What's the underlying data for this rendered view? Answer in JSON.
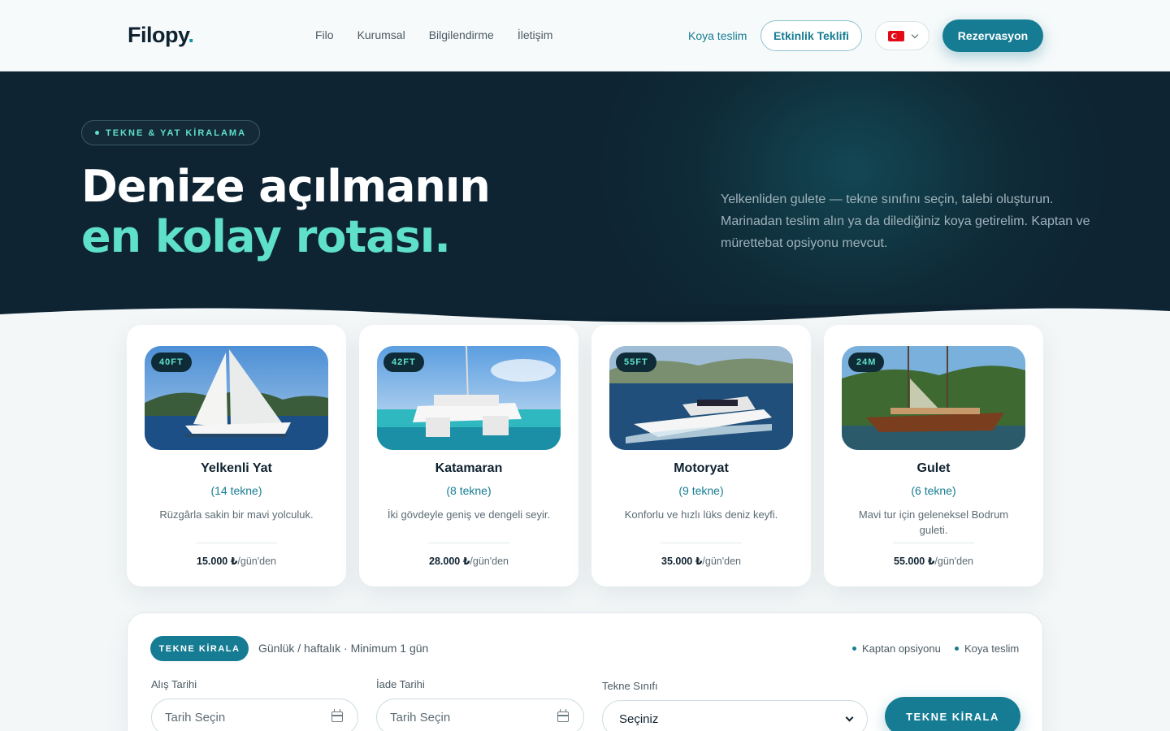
{
  "header": {
    "logo": "Filopy",
    "logo_dot": ".",
    "nav": [
      "Filo",
      "Kurumsal",
      "Bilgilendirme",
      "İletişim"
    ],
    "koya_link": "Koya teslim",
    "etkinlik_button": "Etkinlik Teklifi",
    "language_flag": "turkey-flag-icon",
    "reservation_button": "Rezervasyon"
  },
  "hero": {
    "badge": "TEKNE & YAT KİRALAMA",
    "title_line1": "Denize açılmanın",
    "title_line2": "en kolay rotası.",
    "description": "Yelkenliden gulete — tekne sınıfını seçin, talebi oluşturun. Marinadan teslim alın ya da dilediğiniz koya getirelim. Kaptan ve mürettebat opsiyonu mevcut."
  },
  "cards": [
    {
      "tag": "40FT",
      "title": "Yelkenli Yat",
      "count": "(14 tekne)",
      "description": "Rüzgârla sakin bir mavi yolculuk.",
      "price": "15.000 ₺",
      "unit": "/gün'den"
    },
    {
      "tag": "42FT",
      "title": "Katamaran",
      "count": "(8 tekne)",
      "description": "İki gövdeyle geniş ve dengeli seyir.",
      "price": "28.000 ₺",
      "unit": "/gün'den"
    },
    {
      "tag": "55FT",
      "title": "Motoryat",
      "count": "(9 tekne)",
      "description": "Konforlu ve hızlı lüks deniz keyfi.",
      "price": "35.000 ₺",
      "unit": "/gün'den"
    },
    {
      "tag": "24M",
      "title": "Gulet",
      "count": "(6 tekne)",
      "description": "Mavi tur için geleneksel Bodrum guleti.",
      "price": "55.000 ₺",
      "unit": "/gün'den"
    }
  ],
  "booking": {
    "pill": "TEKNE KİRALA",
    "subtitle": "Günlük / haftalık · Minimum 1 gün",
    "options": [
      "Kaptan opsiyonu",
      "Koya teslim"
    ],
    "pickup_label": "Alış Tarihi",
    "pickup_placeholder": "Tarih Seçin",
    "return_label": "İade Tarihi",
    "return_placeholder": "Tarih Seçin",
    "class_label": "Tekne Sınıfı",
    "class_value": "Seçiniz",
    "submit": "TEKNE KİRALA"
  },
  "colors": {
    "accent": "#167c93",
    "mint": "#5fe0c8",
    "navy": "#0f2b38"
  }
}
